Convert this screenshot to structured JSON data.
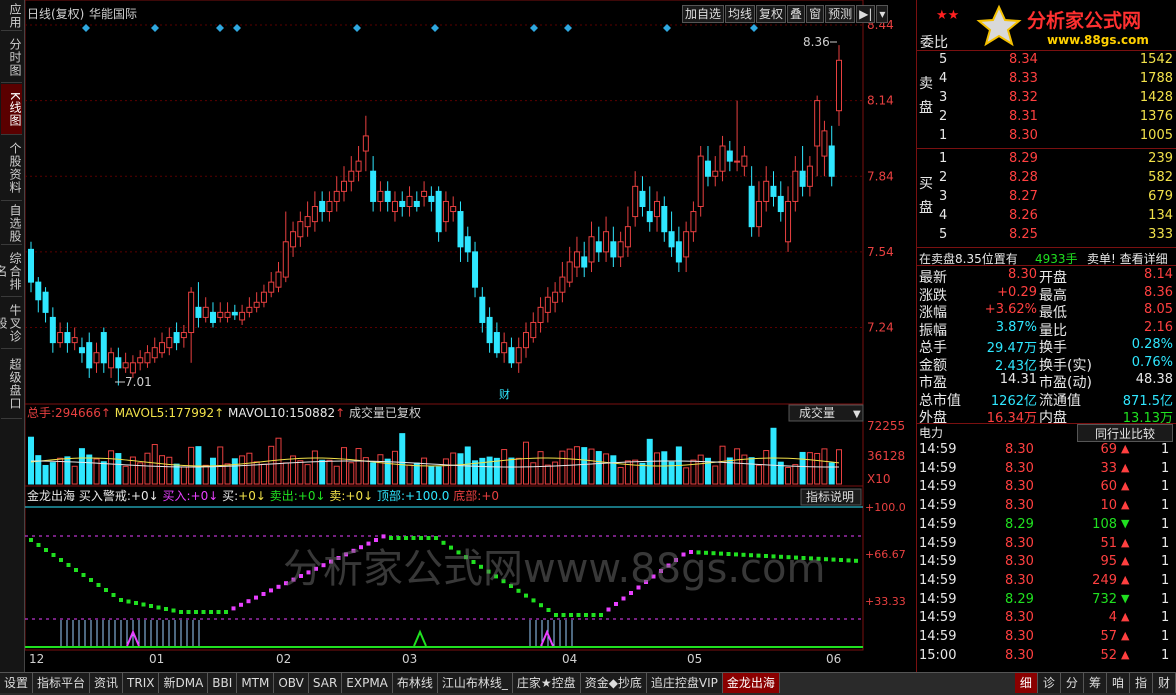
{
  "left_tabs": [
    "应用",
    "分时图",
    "K线图",
    "个股资料",
    "自选股",
    "综合排名",
    "牛叉诊股",
    "超级盘口"
  ],
  "header": {
    "period": "日线(复权)",
    "stock_name": "华能国际"
  },
  "toolbar": [
    "加自选",
    "均线",
    "复权",
    "叠",
    "窗",
    "预测",
    "▶|",
    "▾"
  ],
  "price_axis": [
    "8.44",
    "8.14",
    "7.84",
    "7.54",
    "7.24"
  ],
  "annotations": {
    "high": "8.36",
    "low": "7.01",
    "finance_tag": "财"
  },
  "volume_panel": {
    "legend_total_label": "总手:",
    "legend_total": "294666",
    "legend_ma5_label": "MAVOL5:",
    "legend_ma5": "177992",
    "legend_ma10_label": "MAVOL10:",
    "legend_ma10": "150882",
    "legend_note": "成交量已复权",
    "selector": "成交量",
    "axis": [
      "72255",
      "36128",
      "X10"
    ]
  },
  "indicator_panel": {
    "name": "金龙出海",
    "items": [
      {
        "label": "买入警戒:",
        "value": "+0"
      },
      {
        "label": "买入:",
        "value": "+0"
      },
      {
        "label": "买:",
        "value": "+0"
      },
      {
        "label": "卖出:",
        "value": "+0"
      },
      {
        "label": "卖:",
        "value": "+0"
      },
      {
        "label": "顶部:",
        "value": "+100.0"
      },
      {
        "label": "底部:",
        "value": "+0"
      }
    ],
    "help_button": "指标说明",
    "axis": [
      "+100.0",
      "+66.67",
      "+33.33"
    ]
  },
  "watermark": "分析家公式网www.88gs.com",
  "x_axis": [
    "12",
    "01",
    "02",
    "03",
    "04",
    "05",
    "06"
  ],
  "chart_data": {
    "type": "candlestick",
    "ylim": [
      7.0,
      8.44
    ],
    "candles": [
      [
        7.55,
        7.42,
        7.58,
        7.38
      ],
      [
        7.42,
        7.35,
        7.44,
        7.3
      ],
      [
        7.38,
        7.3,
        7.4,
        7.26
      ],
      [
        7.28,
        7.18,
        7.32,
        7.14
      ],
      [
        7.18,
        7.22,
        7.26,
        7.16
      ],
      [
        7.22,
        7.18,
        7.26,
        7.14
      ],
      [
        7.18,
        7.2,
        7.24,
        7.15
      ],
      [
        7.16,
        7.14,
        7.2,
        7.1
      ],
      [
        7.18,
        7.08,
        7.22,
        7.04
      ],
      [
        7.1,
        7.14,
        7.18,
        7.06
      ],
      [
        7.22,
        7.1,
        7.24,
        7.06
      ],
      [
        7.08,
        7.14,
        7.16,
        7.04
      ],
      [
        7.12,
        7.08,
        7.16,
        7.01
      ],
      [
        7.08,
        7.1,
        7.14,
        7.06
      ],
      [
        7.06,
        7.1,
        7.13,
        7.04
      ],
      [
        7.1,
        7.12,
        7.15,
        7.07
      ],
      [
        7.1,
        7.14,
        7.17,
        7.08
      ],
      [
        7.12,
        7.16,
        7.2,
        7.1
      ],
      [
        7.14,
        7.18,
        7.22,
        7.12
      ],
      [
        7.16,
        7.2,
        7.24,
        7.13
      ],
      [
        7.22,
        7.18,
        7.26,
        7.15
      ],
      [
        7.2,
        7.22,
        7.25,
        7.16
      ],
      [
        7.22,
        7.38,
        7.4,
        7.1
      ],
      [
        7.32,
        7.28,
        7.42,
        7.24
      ],
      [
        7.28,
        7.32,
        7.36,
        7.26
      ],
      [
        7.3,
        7.26,
        7.34,
        7.24
      ],
      [
        7.28,
        7.3,
        7.34,
        7.26
      ],
      [
        7.28,
        7.3,
        7.34,
        7.26
      ],
      [
        7.3,
        7.29,
        7.33,
        7.27
      ],
      [
        7.27,
        7.3,
        7.33,
        7.25
      ],
      [
        7.3,
        7.32,
        7.36,
        7.28
      ],
      [
        7.32,
        7.34,
        7.38,
        7.3
      ],
      [
        7.34,
        7.38,
        7.41,
        7.32
      ],
      [
        7.38,
        7.42,
        7.46,
        7.36
      ],
      [
        7.4,
        7.46,
        7.5,
        7.38
      ],
      [
        7.44,
        7.58,
        7.7,
        7.42
      ],
      [
        7.56,
        7.62,
        7.66,
        7.52
      ],
      [
        7.6,
        7.66,
        7.7,
        7.56
      ],
      [
        7.64,
        7.68,
        7.74,
        7.6
      ],
      [
        7.66,
        7.72,
        7.78,
        7.62
      ],
      [
        7.74,
        7.7,
        7.78,
        7.66
      ],
      [
        7.7,
        7.74,
        7.78,
        7.66
      ],
      [
        7.74,
        7.78,
        7.84,
        7.7
      ],
      [
        7.78,
        7.82,
        7.88,
        7.74
      ],
      [
        7.82,
        7.86,
        7.92,
        7.78
      ],
      [
        7.86,
        7.9,
        7.96,
        7.82
      ],
      [
        7.94,
        8.0,
        8.08,
        7.86
      ],
      [
        7.86,
        7.74,
        7.92,
        7.7
      ],
      [
        7.74,
        7.78,
        7.82,
        7.7
      ],
      [
        7.78,
        7.74,
        7.82,
        7.7
      ],
      [
        7.7,
        7.74,
        7.78,
        7.66
      ],
      [
        7.74,
        7.72,
        7.78,
        7.68
      ],
      [
        7.72,
        7.76,
        7.8,
        7.68
      ],
      [
        7.74,
        7.72,
        7.78,
        7.7
      ],
      [
        7.76,
        7.78,
        7.82,
        7.72
      ],
      [
        7.76,
        7.74,
        7.8,
        7.7
      ],
      [
        7.78,
        7.62,
        7.8,
        7.58
      ],
      [
        7.66,
        7.74,
        7.78,
        7.62
      ],
      [
        7.7,
        7.72,
        7.76,
        7.66
      ],
      [
        7.7,
        7.56,
        7.74,
        7.5
      ],
      [
        7.6,
        7.54,
        7.64,
        7.5
      ],
      [
        7.54,
        7.4,
        7.58,
        7.36
      ],
      [
        7.36,
        7.26,
        7.4,
        7.22
      ],
      [
        7.28,
        7.18,
        7.32,
        7.14
      ],
      [
        7.22,
        7.14,
        7.26,
        7.12
      ],
      [
        7.14,
        7.18,
        7.22,
        7.1
      ],
      [
        7.16,
        7.1,
        7.2,
        7.08
      ],
      [
        7.1,
        7.16,
        7.2,
        7.06
      ],
      [
        7.16,
        7.22,
        7.26,
        7.12
      ],
      [
        7.2,
        7.26,
        7.3,
        7.18
      ],
      [
        7.26,
        7.32,
        7.36,
        7.22
      ],
      [
        7.3,
        7.36,
        7.4,
        7.26
      ],
      [
        7.34,
        7.38,
        7.42,
        7.3
      ],
      [
        7.38,
        7.44,
        7.5,
        7.34
      ],
      [
        7.42,
        7.5,
        7.56,
        7.4
      ],
      [
        7.48,
        7.54,
        7.6,
        7.44
      ],
      [
        7.52,
        7.48,
        7.58,
        7.44
      ],
      [
        7.5,
        7.6,
        7.66,
        7.46
      ],
      [
        7.58,
        7.54,
        7.64,
        7.5
      ],
      [
        7.54,
        7.62,
        7.68,
        7.5
      ],
      [
        7.58,
        7.52,
        7.64,
        7.48
      ],
      [
        7.52,
        7.58,
        7.62,
        7.48
      ],
      [
        7.56,
        7.64,
        7.72,
        7.52
      ],
      [
        7.68,
        7.8,
        7.86,
        7.64
      ],
      [
        7.78,
        7.72,
        7.84,
        7.68
      ],
      [
        7.7,
        7.66,
        7.8,
        7.62
      ],
      [
        7.68,
        7.74,
        7.78,
        7.62
      ],
      [
        7.72,
        7.62,
        7.76,
        7.58
      ],
      [
        7.62,
        7.56,
        7.7,
        7.52
      ],
      [
        7.58,
        7.5,
        7.64,
        7.46
      ],
      [
        7.52,
        7.62,
        7.66,
        7.46
      ],
      [
        7.62,
        7.7,
        7.74,
        7.58
      ],
      [
        7.72,
        7.92,
        7.96,
        7.68
      ],
      [
        7.9,
        7.84,
        7.96,
        7.8
      ],
      [
        7.84,
        7.86,
        7.92,
        7.8
      ],
      [
        7.86,
        7.96,
        8.0,
        7.82
      ],
      [
        7.94,
        7.9,
        7.98,
        7.86
      ],
      [
        7.9,
        7.9,
        8.14,
        7.86
      ],
      [
        7.88,
        7.92,
        7.96,
        7.84
      ],
      [
        7.8,
        7.64,
        7.88,
        7.6
      ],
      [
        7.64,
        7.74,
        7.82,
        7.6
      ],
      [
        7.74,
        7.82,
        7.88,
        7.7
      ],
      [
        7.8,
        7.76,
        7.86,
        7.72
      ],
      [
        7.76,
        7.7,
        7.82,
        7.66
      ],
      [
        7.58,
        7.74,
        7.8,
        7.54
      ],
      [
        7.74,
        7.86,
        7.92,
        7.7
      ],
      [
        7.86,
        7.8,
        7.96,
        7.76
      ],
      [
        7.8,
        7.88,
        7.92,
        7.76
      ],
      [
        7.96,
        8.14,
        8.16,
        7.84
      ],
      [
        7.92,
        8.02,
        8.06,
        7.84
      ],
      [
        7.96,
        7.84,
        8.04,
        7.8
      ],
      [
        8.1,
        8.3,
        8.36,
        8.04
      ]
    ]
  },
  "right_panel": {
    "header": "委比",
    "sell_label": "卖盘",
    "buy_label": "买盘",
    "sell_orders": [
      {
        "lvl": "5",
        "price": "8.34",
        "vol": "1542"
      },
      {
        "lvl": "4",
        "price": "8.33",
        "vol": "1788"
      },
      {
        "lvl": "3",
        "price": "8.32",
        "vol": "1428"
      },
      {
        "lvl": "2",
        "price": "8.31",
        "vol": "1376"
      },
      {
        "lvl": "1",
        "price": "8.30",
        "vol": "1005"
      }
    ],
    "buy_orders": [
      {
        "lvl": "1",
        "price": "8.29",
        "vol": "239"
      },
      {
        "lvl": "2",
        "price": "8.28",
        "vol": "582"
      },
      {
        "lvl": "3",
        "price": "8.27",
        "vol": "679"
      },
      {
        "lvl": "4",
        "price": "8.26",
        "vol": "134"
      },
      {
        "lvl": "5",
        "price": "8.25",
        "vol": "333"
      }
    ],
    "notice_left": "在卖盘8.35位置有",
    "notice_vol": "4933手",
    "notice_right": "卖单! 查看详细",
    "stats_left": [
      {
        "label": "最新",
        "value": "8.30",
        "color": "red"
      },
      {
        "label": "涨跌",
        "value": "+0.29",
        "color": "red"
      },
      {
        "label": "涨幅",
        "value": "+3.62%",
        "color": "red"
      },
      {
        "label": "振幅",
        "value": "3.87%",
        "color": "cyan"
      },
      {
        "label": "总手",
        "value": "29.47万",
        "color": "cyan"
      },
      {
        "label": "金额",
        "value": "2.43亿",
        "color": "cyan"
      },
      {
        "label": "市盈",
        "value": "14.31",
        "color": "white"
      },
      {
        "label": "总市值",
        "value": "1262亿",
        "color": "cyan"
      },
      {
        "label": "外盘",
        "value": "16.34万",
        "color": "red"
      }
    ],
    "stats_right": [
      {
        "label": "开盘",
        "value": "8.14",
        "color": "red"
      },
      {
        "label": "最高",
        "value": "8.36",
        "color": "red"
      },
      {
        "label": "最低",
        "value": "8.05",
        "color": "red"
      },
      {
        "label": "量比",
        "value": "2.16",
        "color": "red"
      },
      {
        "label": "换手",
        "value": "0.28%",
        "color": "cyan"
      },
      {
        "label": "换手(实)",
        "value": "0.76%",
        "color": "cyan"
      },
      {
        "label": "市盈(动)",
        "value": "48.38",
        "color": "white"
      },
      {
        "label": "流通值",
        "value": "871.5亿",
        "color": "cyan"
      },
      {
        "label": "内盘",
        "value": "13.13万",
        "color": "green"
      }
    ],
    "industry": "电力",
    "compare_button": "同行业比较",
    "ticks": [
      {
        "t": "14:59",
        "p": "8.30",
        "v": "69",
        "d": "up"
      },
      {
        "t": "14:59",
        "p": "8.30",
        "v": "33",
        "d": "up"
      },
      {
        "t": "14:59",
        "p": "8.30",
        "v": "60",
        "d": "up"
      },
      {
        "t": "14:59",
        "p": "8.30",
        "v": "10",
        "d": "up"
      },
      {
        "t": "14:59",
        "p": "8.29",
        "v": "108",
        "d": "down"
      },
      {
        "t": "14:59",
        "p": "8.30",
        "v": "51",
        "d": "up"
      },
      {
        "t": "14:59",
        "p": "8.30",
        "v": "95",
        "d": "up"
      },
      {
        "t": "14:59",
        "p": "8.30",
        "v": "249",
        "d": "up"
      },
      {
        "t": "14:59",
        "p": "8.29",
        "v": "732",
        "d": "down"
      },
      {
        "t": "14:59",
        "p": "8.30",
        "v": "4",
        "d": "up"
      },
      {
        "t": "14:59",
        "p": "8.30",
        "v": "57",
        "d": "up"
      },
      {
        "t": "15:00",
        "p": "8.30",
        "v": "52",
        "d": "up"
      }
    ],
    "tick_count": "1",
    "bottom_tabs": [
      "细",
      "诊",
      "分",
      "筹",
      "咱",
      "指",
      "财"
    ]
  },
  "logo_text": "分析家公式网",
  "logo_url": "www.88gs.com",
  "bottom_tabs": [
    "设置",
    "指标平台",
    "资讯",
    "TRIX",
    "新DMA",
    "BBI",
    "MTM",
    "OBV",
    "SAR",
    "EXPMA",
    "布林线",
    "江山布林线_",
    "庄家★控盘",
    "资金◆抄底",
    "追庄控盘VIP",
    "金龙出海"
  ]
}
